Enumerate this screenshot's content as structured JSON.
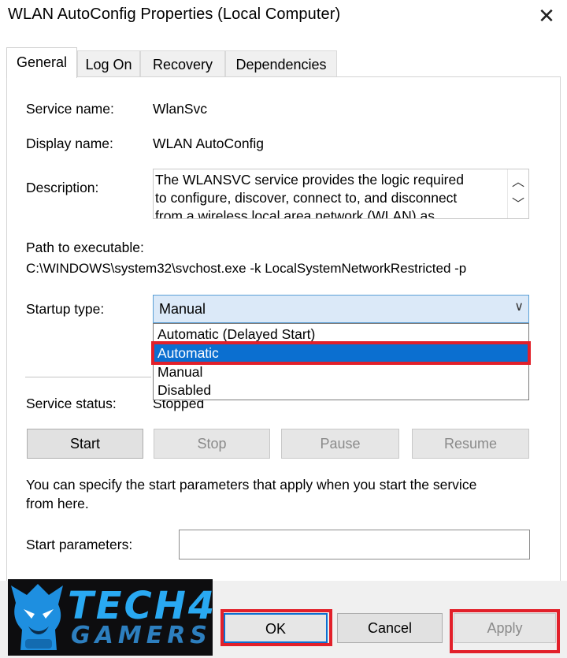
{
  "window": {
    "title": "WLAN AutoConfig Properties (Local Computer)",
    "close_glyph": "✕"
  },
  "tabs": [
    {
      "label": "General",
      "active": true
    },
    {
      "label": "Log On",
      "active": false
    },
    {
      "label": "Recovery",
      "active": false
    },
    {
      "label": "Dependencies",
      "active": false
    }
  ],
  "general": {
    "service_name_label": "Service name:",
    "service_name_value": "WlanSvc",
    "display_name_label": "Display name:",
    "display_name_value": "WLAN AutoConfig",
    "description_label": "Description:",
    "description_lines": [
      "The WLANSVC service provides the logic required",
      "to configure, discover, connect to, and disconnect",
      "from a wireless local area network (WLAN) as"
    ],
    "scroll_up_glyph": "︿",
    "scroll_down_glyph": "﹀",
    "path_label": "Path to executable:",
    "path_value": "C:\\WINDOWS\\system32\\svchost.exe -k LocalSystemNetworkRestricted -p",
    "startup_type_label": "Startup type:",
    "startup_type_value": "Manual",
    "startup_chevron": "∨",
    "startup_options": [
      {
        "label": "Automatic (Delayed Start)",
        "selected": false
      },
      {
        "label": "Automatic",
        "selected": true
      },
      {
        "label": "Manual",
        "selected": false
      },
      {
        "label": "Disabled",
        "selected": false
      }
    ],
    "service_status_label": "Service status:",
    "service_status_value": "Stopped",
    "buttons": {
      "start": "Start",
      "stop": "Stop",
      "pause": "Pause",
      "resume": "Resume"
    },
    "hint_lines": [
      "You can specify the start parameters that apply when you start the service",
      "from here."
    ],
    "start_params_label": "Start parameters:",
    "start_params_value": ""
  },
  "footer_buttons": {
    "ok": "OK",
    "cancel": "Cancel",
    "apply": "Apply"
  },
  "watermark": {
    "line1": "TECH4",
    "line2": "GAMERS"
  },
  "colors": {
    "highlight": "#e2202a",
    "selection": "#0b6fd0",
    "combo_bg": "#dbe9f8"
  }
}
